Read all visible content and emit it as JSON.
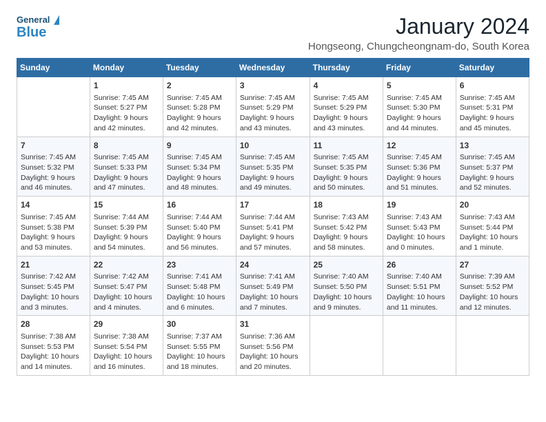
{
  "header": {
    "logo_general": "General",
    "logo_blue": "Blue",
    "month_year": "January 2024",
    "location": "Hongseong, Chungcheongnam-do, South Korea"
  },
  "days_of_week": [
    "Sunday",
    "Monday",
    "Tuesday",
    "Wednesday",
    "Thursday",
    "Friday",
    "Saturday"
  ],
  "weeks": [
    [
      {
        "day": "",
        "info": ""
      },
      {
        "day": "1",
        "info": "Sunrise: 7:45 AM\nSunset: 5:27 PM\nDaylight: 9 hours\nand 42 minutes."
      },
      {
        "day": "2",
        "info": "Sunrise: 7:45 AM\nSunset: 5:28 PM\nDaylight: 9 hours\nand 42 minutes."
      },
      {
        "day": "3",
        "info": "Sunrise: 7:45 AM\nSunset: 5:29 PM\nDaylight: 9 hours\nand 43 minutes."
      },
      {
        "day": "4",
        "info": "Sunrise: 7:45 AM\nSunset: 5:29 PM\nDaylight: 9 hours\nand 43 minutes."
      },
      {
        "day": "5",
        "info": "Sunrise: 7:45 AM\nSunset: 5:30 PM\nDaylight: 9 hours\nand 44 minutes."
      },
      {
        "day": "6",
        "info": "Sunrise: 7:45 AM\nSunset: 5:31 PM\nDaylight: 9 hours\nand 45 minutes."
      }
    ],
    [
      {
        "day": "7",
        "info": "Sunrise: 7:45 AM\nSunset: 5:32 PM\nDaylight: 9 hours\nand 46 minutes."
      },
      {
        "day": "8",
        "info": "Sunrise: 7:45 AM\nSunset: 5:33 PM\nDaylight: 9 hours\nand 47 minutes."
      },
      {
        "day": "9",
        "info": "Sunrise: 7:45 AM\nSunset: 5:34 PM\nDaylight: 9 hours\nand 48 minutes."
      },
      {
        "day": "10",
        "info": "Sunrise: 7:45 AM\nSunset: 5:35 PM\nDaylight: 9 hours\nand 49 minutes."
      },
      {
        "day": "11",
        "info": "Sunrise: 7:45 AM\nSunset: 5:35 PM\nDaylight: 9 hours\nand 50 minutes."
      },
      {
        "day": "12",
        "info": "Sunrise: 7:45 AM\nSunset: 5:36 PM\nDaylight: 9 hours\nand 51 minutes."
      },
      {
        "day": "13",
        "info": "Sunrise: 7:45 AM\nSunset: 5:37 PM\nDaylight: 9 hours\nand 52 minutes."
      }
    ],
    [
      {
        "day": "14",
        "info": "Sunrise: 7:45 AM\nSunset: 5:38 PM\nDaylight: 9 hours\nand 53 minutes."
      },
      {
        "day": "15",
        "info": "Sunrise: 7:44 AM\nSunset: 5:39 PM\nDaylight: 9 hours\nand 54 minutes."
      },
      {
        "day": "16",
        "info": "Sunrise: 7:44 AM\nSunset: 5:40 PM\nDaylight: 9 hours\nand 56 minutes."
      },
      {
        "day": "17",
        "info": "Sunrise: 7:44 AM\nSunset: 5:41 PM\nDaylight: 9 hours\nand 57 minutes."
      },
      {
        "day": "18",
        "info": "Sunrise: 7:43 AM\nSunset: 5:42 PM\nDaylight: 9 hours\nand 58 minutes."
      },
      {
        "day": "19",
        "info": "Sunrise: 7:43 AM\nSunset: 5:43 PM\nDaylight: 10 hours\nand 0 minutes."
      },
      {
        "day": "20",
        "info": "Sunrise: 7:43 AM\nSunset: 5:44 PM\nDaylight: 10 hours\nand 1 minute."
      }
    ],
    [
      {
        "day": "21",
        "info": "Sunrise: 7:42 AM\nSunset: 5:45 PM\nDaylight: 10 hours\nand 3 minutes."
      },
      {
        "day": "22",
        "info": "Sunrise: 7:42 AM\nSunset: 5:47 PM\nDaylight: 10 hours\nand 4 minutes."
      },
      {
        "day": "23",
        "info": "Sunrise: 7:41 AM\nSunset: 5:48 PM\nDaylight: 10 hours\nand 6 minutes."
      },
      {
        "day": "24",
        "info": "Sunrise: 7:41 AM\nSunset: 5:49 PM\nDaylight: 10 hours\nand 7 minutes."
      },
      {
        "day": "25",
        "info": "Sunrise: 7:40 AM\nSunset: 5:50 PM\nDaylight: 10 hours\nand 9 minutes."
      },
      {
        "day": "26",
        "info": "Sunrise: 7:40 AM\nSunset: 5:51 PM\nDaylight: 10 hours\nand 11 minutes."
      },
      {
        "day": "27",
        "info": "Sunrise: 7:39 AM\nSunset: 5:52 PM\nDaylight: 10 hours\nand 12 minutes."
      }
    ],
    [
      {
        "day": "28",
        "info": "Sunrise: 7:38 AM\nSunset: 5:53 PM\nDaylight: 10 hours\nand 14 minutes."
      },
      {
        "day": "29",
        "info": "Sunrise: 7:38 AM\nSunset: 5:54 PM\nDaylight: 10 hours\nand 16 minutes."
      },
      {
        "day": "30",
        "info": "Sunrise: 7:37 AM\nSunset: 5:55 PM\nDaylight: 10 hours\nand 18 minutes."
      },
      {
        "day": "31",
        "info": "Sunrise: 7:36 AM\nSunset: 5:56 PM\nDaylight: 10 hours\nand 20 minutes."
      },
      {
        "day": "",
        "info": ""
      },
      {
        "day": "",
        "info": ""
      },
      {
        "day": "",
        "info": ""
      }
    ]
  ]
}
